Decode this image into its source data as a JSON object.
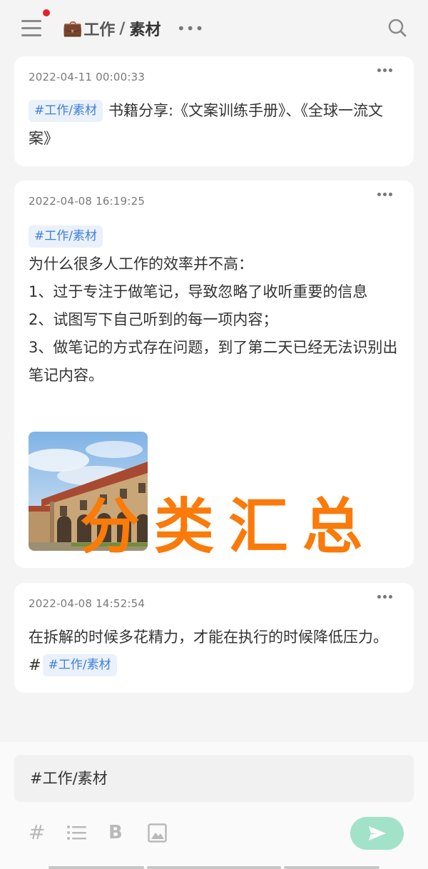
{
  "header": {
    "title_parent": "工作",
    "title_separator": "/",
    "title_leaf": "素材",
    "more": "•••",
    "icons": [
      "menu-icon",
      "briefcase-icon",
      "search-icon"
    ]
  },
  "notes": [
    {
      "date": "2022-04-11 00:00:33",
      "tag": "#工作/素材",
      "text": "书籍分享:《文案训练手册》、《全球一流文案》"
    },
    {
      "date": "2022-04-08 16:19:25",
      "tag": "#工作/素材",
      "lines": [
        "为什么很多人工作的效率并不高：",
        "1、过于专注于做笔记，导致忽略了收听重要的信息",
        "2、试图写下自己听到的每一项内容；",
        "3、做笔记的方式存在问题，到了第二天已经无法识别出笔记内容。"
      ],
      "overlay": "分类汇总"
    },
    {
      "date": "2022-04-08 14:52:54",
      "text": "在拆解的时候多花精力，才能在执行的时候降低压力。#",
      "tag": "#工作/素材"
    }
  ],
  "editor": {
    "input_value": "#工作/素材",
    "toolbar": {
      "hash": "#",
      "bold": "B",
      "icons": [
        "hash-icon",
        "list-icon",
        "bold-icon",
        "image-icon",
        "send-icon"
      ]
    }
  },
  "colors": {
    "accent_green": "#a2e2c8",
    "tag_blue": "#3f7fd8",
    "overlay_orange": "#fa7a0a",
    "notification_red": "#e5222b"
  }
}
